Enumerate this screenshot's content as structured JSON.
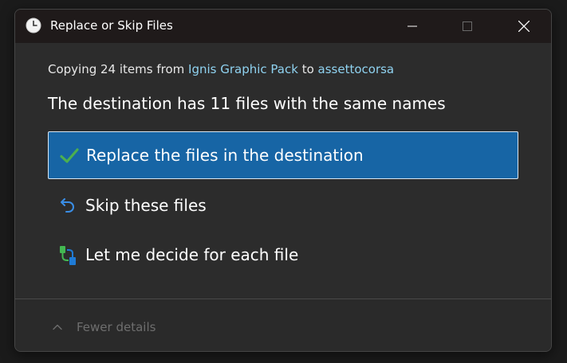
{
  "window": {
    "title": "Replace or Skip Files",
    "icon": "clock-icon",
    "controls": [
      "minimize-icon",
      "maximize-icon",
      "close-icon"
    ]
  },
  "summary": {
    "prefix": "Copying 24 items from ",
    "source": "Ignis Graphic Pack",
    "middle": " to ",
    "destination": "assettocorsa"
  },
  "heading": "The destination has 11 files with the same names",
  "options": [
    {
      "label": "Replace the files in the destination",
      "icon": "check-icon",
      "selected": true
    },
    {
      "label": "Skip these files",
      "icon": "undo-arrow-icon",
      "selected": false
    },
    {
      "label": "Let me decide for each file",
      "icon": "compare-files-icon",
      "selected": false
    }
  ],
  "footer": {
    "details_label": "Fewer details",
    "icon": "chevron-up-icon"
  },
  "colors": {
    "accent": "#1765a5",
    "link": "#8fd2f0",
    "check": "#4caf50",
    "background": "#2c2c2c"
  }
}
